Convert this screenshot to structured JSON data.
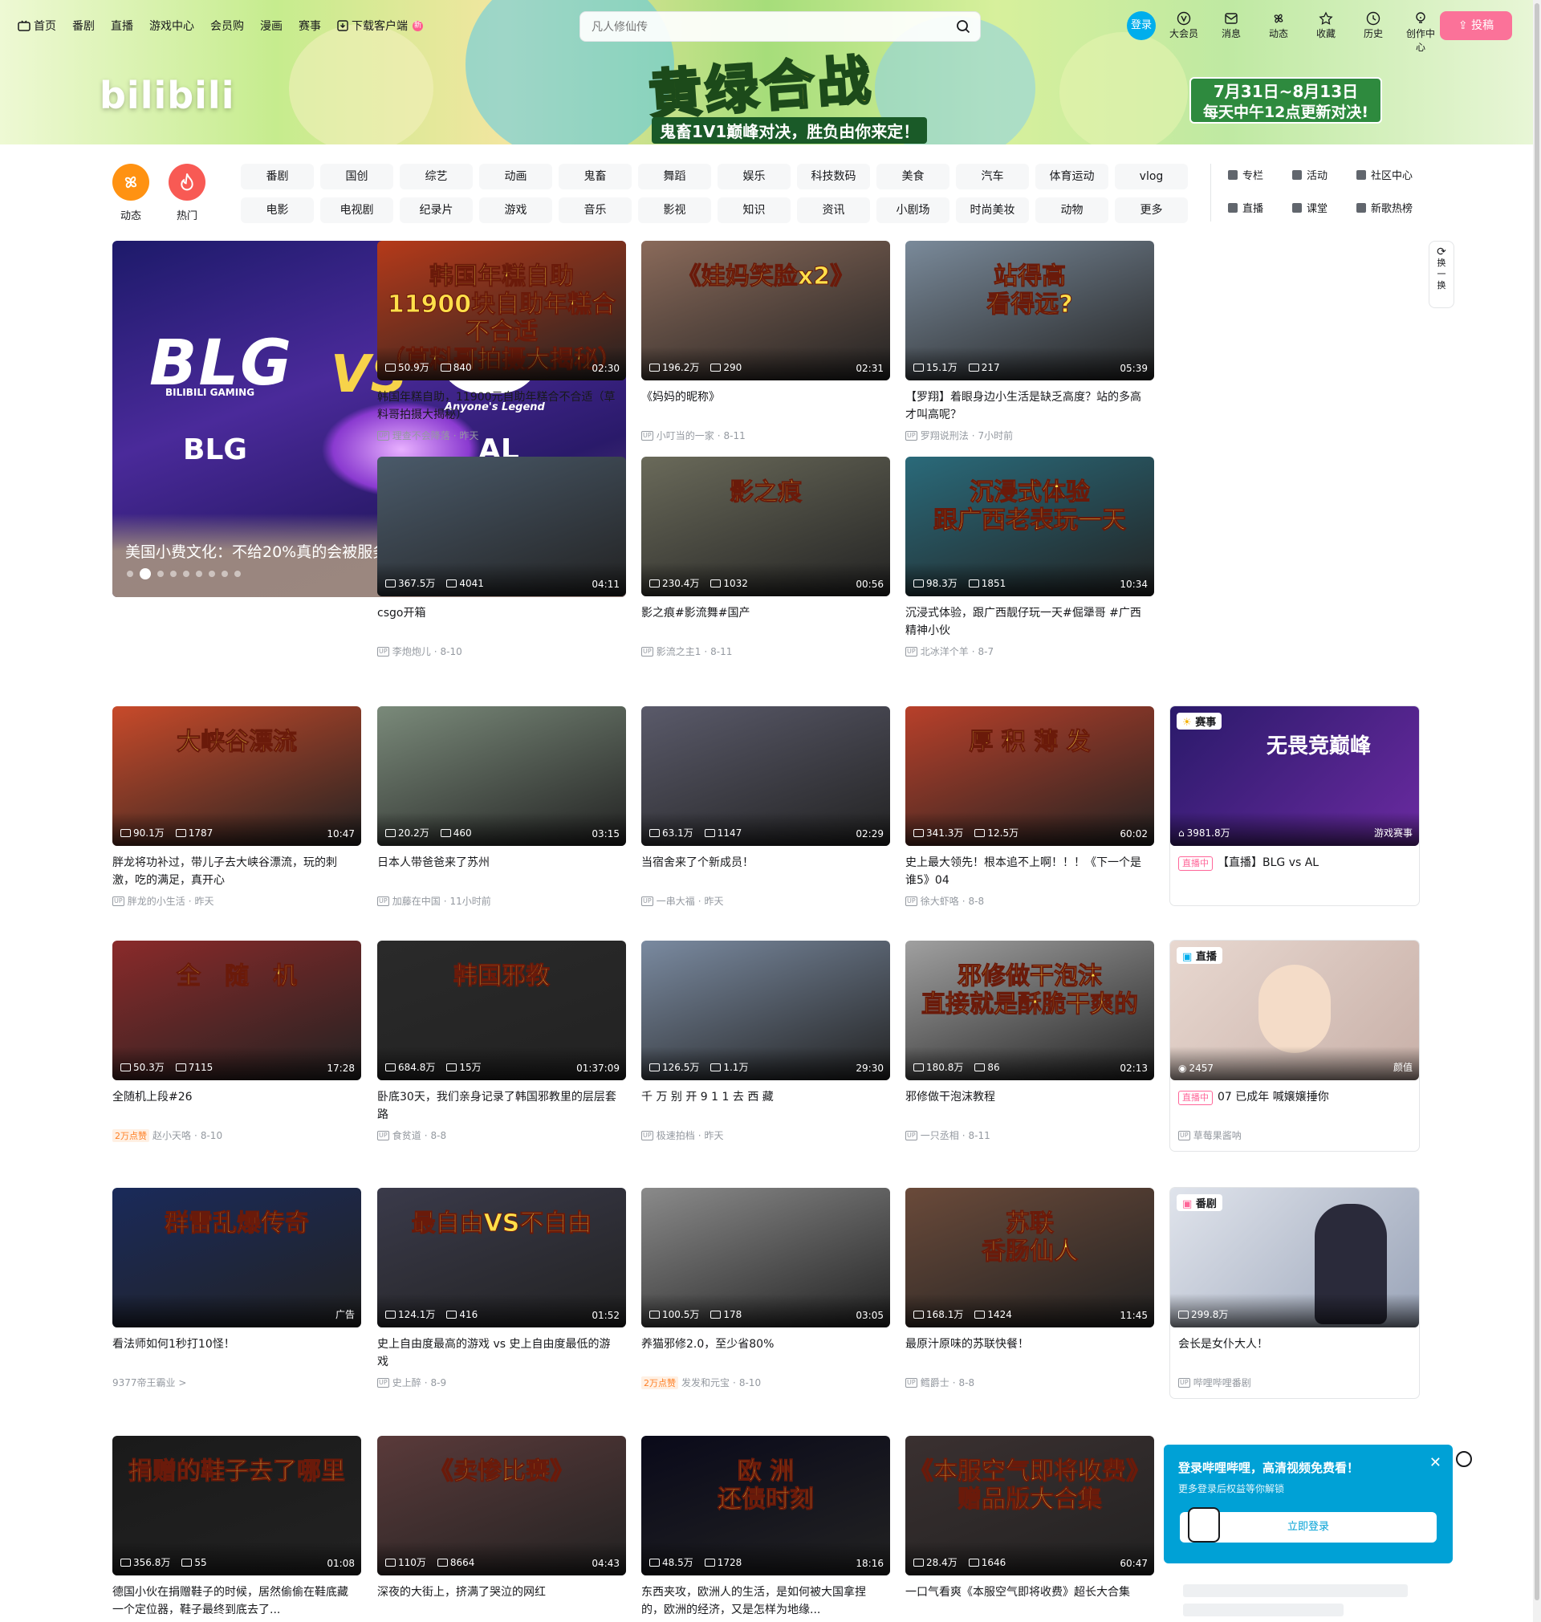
{
  "nav": {
    "left": [
      "首页",
      "番剧",
      "直播",
      "游戏中心",
      "会员购",
      "漫画",
      "赛事",
      "下载客户端"
    ],
    "new_badge": "新",
    "search_placeholder": "凡人修仙传",
    "login": "登录",
    "right": [
      "大会员",
      "消息",
      "动态",
      "收藏",
      "历史",
      "创作中心"
    ],
    "upload": "投稿"
  },
  "banner": {
    "logo": "bilibili",
    "title": "黄绿合战",
    "subtitle": "鬼畜1V1巅峰对决，胜负由你来定！",
    "date_line1": "7月31日~8月13日",
    "date_line2": "每天中午12点更新对决!"
  },
  "channels": {
    "icons": [
      "动态",
      "热门"
    ],
    "row1": [
      "番剧",
      "国创",
      "综艺",
      "动画",
      "鬼畜",
      "舞蹈",
      "娱乐",
      "科技数码",
      "美食",
      "汽车",
      "体育运动",
      "vlog"
    ],
    "row2": [
      "电影",
      "电视剧",
      "纪录片",
      "游戏",
      "音乐",
      "影视",
      "知识",
      "资讯",
      "小剧场",
      "时尚美妆",
      "动物",
      "更多"
    ],
    "extra": [
      "专栏",
      "活动",
      "社区中心",
      "直播",
      "课堂",
      "新歌热榜"
    ]
  },
  "carousel": {
    "title": "美国小费文化：不给20%真的会被服务员追着骂吗？",
    "team1": "BLG",
    "team1_sub": "BILIBILI GAMING",
    "vs": "VS",
    "team2": "AL",
    "team2_sub": "Anyone's Legend",
    "slide_count": 9,
    "active_slide": 1
  },
  "refresh": [
    "换",
    "一",
    "换"
  ],
  "cards": [
    {
      "thumb_text": "韩国年糕自助\n11900块自助年糕合不合适\n（草料哥拍摄大揭秘）",
      "thumb_bg": "#b53a1a",
      "views": "50.9万",
      "danmaku": "840",
      "duration": "02:30",
      "title": "韩国年糕自助，11900元自助年糕合不合适（草料哥拍摄大揭秘）",
      "author": "理查不会降落",
      "date": "昨天"
    },
    {
      "thumb_text": "《娃妈笑脸x2》",
      "thumb_bg": "#8a6a5a",
      "views": "196.2万",
      "danmaku": "290",
      "duration": "02:31",
      "title": "《妈妈的昵称》",
      "author": "小叮当的一家",
      "date": "8-11"
    },
    {
      "thumb_text": "站得高\n看得远?",
      "thumb_bg": "#7a8a9a",
      "views": "15.1万",
      "danmaku": "217",
      "duration": "05:39",
      "title": "【罗翔】着眼身边小生活是缺乏高度？站的多高才叫高呢？",
      "author": "罗翔说刑法",
      "date": "7小时前"
    },
    {
      "thumb_text": "",
      "thumb_bg": "#4a5a6a",
      "views": "367.5万",
      "danmaku": "4041",
      "duration": "04:11",
      "title": "csgo开箱",
      "author": "李炮炮儿",
      "date": "8-10"
    },
    {
      "thumb_text": "影之痕",
      "thumb_bg": "#6a6a5a",
      "views": "230.4万",
      "danmaku": "1032",
      "duration": "00:56",
      "title": "影之痕#影流舞#国产",
      "author": "影流之主1",
      "date": "8-11"
    },
    {
      "thumb_text": "沉浸式体验\n跟广西老表玩一天",
      "thumb_bg": "#2a6a7a",
      "views": "98.3万",
      "danmaku": "1851",
      "duration": "10:34",
      "title": "沉浸式体验，跟广西靓仔玩一天#倔犟哥 #广西精神小伙",
      "author": "北冰洋个羊",
      "date": "8-7"
    },
    {
      "thumb_text": "大峡谷漂流",
      "thumb_bg": "#c84a2a",
      "views": "90.1万",
      "danmaku": "1787",
      "duration": "10:47",
      "title": "胖龙将功补过，带儿子去大峡谷漂流，玩的刺激，吃的满足，真开心",
      "author": "胖龙的小生活",
      "date": "昨天"
    },
    {
      "thumb_text": "",
      "thumb_bg": "#7a8a7a",
      "views": "20.2万",
      "danmaku": "460",
      "duration": "03:15",
      "title": "日本人带爸爸来了苏州",
      "author": "加藤在中国",
      "date": "11小时前"
    },
    {
      "thumb_text": "",
      "thumb_bg": "#5a5a6a",
      "views": "63.1万",
      "danmaku": "1147",
      "duration": "02:29",
      "title": "当宿舍来了个新成员！",
      "author": "一串大福",
      "date": "昨天"
    },
    {
      "thumb_text": "厚 积 薄 发",
      "thumb_bg": "#b8402a",
      "views": "341.3万",
      "danmaku": "12.5万",
      "duration": "60:02",
      "title": "史上最大领先！根本追不上啊！！！《下一个是谁5》04",
      "author": "徐大虾咯",
      "date": "8-8"
    },
    {
      "thumb_text": "全　随　机",
      "thumb_bg": "#8a2a2a",
      "views": "50.3万",
      "danmaku": "7115",
      "duration": "17:28",
      "title": "全随机上段#26",
      "author": "赵小天咯",
      "date": "8-10",
      "hot": "2万点赞"
    },
    {
      "thumb_text": "韩国邪教",
      "thumb_bg": "#2a2a2a",
      "views": "684.8万",
      "danmaku": "15万",
      "duration": "01:37:09",
      "title": "卧底30天，我们亲身记录了韩国邪教里的层层套路",
      "author": "食贫道",
      "date": "8-8"
    },
    {
      "thumb_text": "",
      "thumb_bg": "#7a8aa0",
      "views": "126.5万",
      "danmaku": "1.1万",
      "duration": "29:30",
      "title": "千 万 别 开 9 1 1 去 西 藏",
      "author": "极速拍档",
      "date": "昨天"
    },
    {
      "thumb_text": "邪修做干泡沫\n直接就是酥脆干爽的",
      "thumb_bg": "#a0a0a0",
      "views": "180.8万",
      "danmaku": "86",
      "duration": "02:13",
      "title": "邪修做干泡沫教程",
      "author": "一只丞相",
      "date": "8-11"
    },
    {
      "thumb_text": "群雷乱爆传奇",
      "thumb_bg": "#1a2a5a",
      "views": "",
      "danmaku": "",
      "duration": "广告",
      "title": "看法师如何1秒打10怪！",
      "author": "9377帝王霸业 >",
      "date": "",
      "ad": true
    },
    {
      "thumb_text": "最自由VS不自由",
      "thumb_bg": "#3a3a4a",
      "views": "124.1万",
      "danmaku": "416",
      "duration": "01:52",
      "title": "史上自由度最高的游戏 vs 史上自由度最低的游戏",
      "author": "史上醉",
      "date": "8-9"
    },
    {
      "thumb_text": "",
      "thumb_bg": "#8a8a8a",
      "views": "100.5万",
      "danmaku": "178",
      "duration": "03:05",
      "title": "养猫邪修2.0，至少省80%",
      "author": "发发和元宝",
      "date": "8-10",
      "hot": "2万点赞"
    },
    {
      "thumb_text": "苏联\n香肠仙人",
      "thumb_bg": "#6a4a3a",
      "views": "168.1万",
      "danmaku": "1424",
      "duration": "11:45",
      "title": "最原汁原味的苏联快餐！",
      "author": "鳕爵士",
      "date": "8-8"
    },
    {
      "thumb_text": "捐赠的鞋子去了哪里",
      "thumb_bg": "#1a1a1a",
      "views": "356.8万",
      "danmaku": "55",
      "duration": "01:08",
      "title": "德国小伙在捐赠鞋子的时候，居然偷偷在鞋底藏一个定位器，鞋子最终到底去了...",
      "author": "",
      "date": ""
    },
    {
      "thumb_text": "《卖惨比赛》",
      "thumb_bg": "#5a3a3a",
      "views": "110万",
      "danmaku": "8664",
      "duration": "04:43",
      "title": "深夜的大街上，挤满了哭泣的网红",
      "author": "",
      "date": ""
    },
    {
      "thumb_text": "欧 洲\n还债时刻",
      "thumb_bg": "#0a0a1a",
      "views": "48.5万",
      "danmaku": "1728",
      "duration": "18:16",
      "title": "东西夹攻，欧洲人的生活，是如何被大国拿捏的，欧洲的经济，又是怎样为地缘...",
      "author": "",
      "date": ""
    },
    {
      "thumb_text": "《本服空气即将收费》\n赠品版大合集",
      "thumb_bg": "#3a3030",
      "views": "28.4万",
      "danmaku": "1646",
      "duration": "60:47",
      "title": "一口气看爽《本服空气即将收费》超长大合集",
      "author": "",
      "date": ""
    }
  ],
  "special": [
    {
      "badge": "赛事",
      "thumb_text": "无畏竞巅峰",
      "viewers": "3981.8万",
      "corner": "游戏赛事",
      "live_tag": "直播中",
      "title": "【直播】BLG vs AL"
    },
    {
      "badge": "直播",
      "viewers": "2457",
      "corner": "颜值",
      "live_tag": "直播中",
      "title": "07 已成年 喊嬢嬢捶你",
      "author": "草莓果酱呐"
    },
    {
      "badge": "番剧",
      "viewers": "299.8万",
      "title": "会长是女仆大人！",
      "author": "哔哩哔哩番剧"
    }
  ],
  "popup": {
    "title": "登录哔哩哔哩，高清视频免费看！",
    "subtitle": "更多登录后权益等你解锁",
    "button": "立即登录"
  }
}
